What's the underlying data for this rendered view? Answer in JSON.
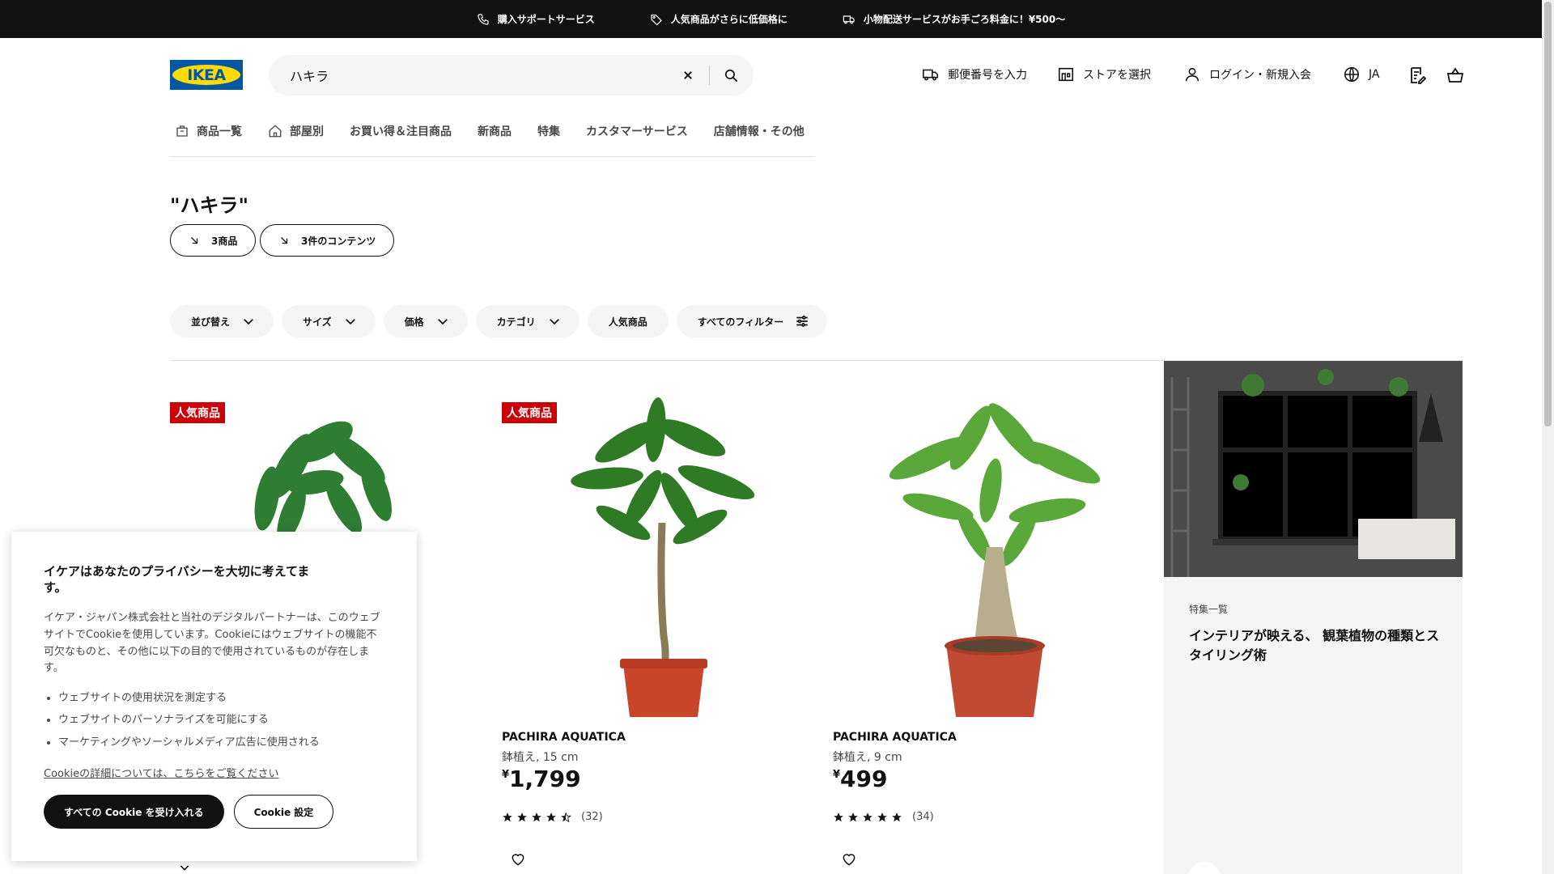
{
  "topbar": {
    "items": [
      {
        "label": "購入サポートサービス",
        "icon": "phone-icon"
      },
      {
        "label": "人気商品がさらに低価格に",
        "icon": "price-tag-icon"
      },
      {
        "label": "小物配送サービスがお手ごろ料金に！¥500〜",
        "icon": "truck-icon"
      }
    ]
  },
  "header": {
    "logo_text": "IKEA",
    "search": {
      "value": "ハキラ"
    },
    "postcode_label": "郵便番号を入力",
    "store_label": "ストアを選択",
    "login_label": "ログイン・新規入会",
    "language_label": "JA"
  },
  "nav": {
    "items": [
      {
        "label": "商品一覧"
      },
      {
        "label": "部屋別"
      },
      {
        "label": "お買い得＆注目商品"
      },
      {
        "label": "新商品"
      },
      {
        "label": "特集"
      },
      {
        "label": "カスタマーサービス"
      },
      {
        "label": "店舗情報・その他"
      }
    ]
  },
  "results": {
    "title": "\"ハキラ\"",
    "products_pill": "3商品",
    "content_pill": "3件のコンテンツ"
  },
  "filters": {
    "sort": "並び替え",
    "size": "サイズ",
    "price": "価格",
    "category": "カテゴリ",
    "popular": "人気商品",
    "all_filters": "すべてのフィルター"
  },
  "products": [
    {
      "badge": "人気商品",
      "name": "",
      "desc": "",
      "currency": "",
      "price": "",
      "rating": null,
      "count": ""
    },
    {
      "badge": "人気商品",
      "name": "PACHIRA AQUATICA",
      "desc": "鉢植え, 15 cm",
      "currency": "¥",
      "price": "1,799",
      "rating": 4.5,
      "count": "(32)"
    },
    {
      "badge": "",
      "name": "PACHIRA AQUATICA",
      "desc": "鉢植え, 9 cm",
      "currency": "¥",
      "price": "499",
      "rating": 5,
      "count": "(34)"
    }
  ],
  "editorial": {
    "kicker": "特集一覧",
    "title": "インテリアが映える、 観葉植物の種類とスタイリング術"
  },
  "cookie": {
    "title": "イケアはあなたのプライバシーを大切に考えてます。",
    "text": "イケア・ジャパン株式会社と当社のデジタルパートナーは、このウェブサイトでCookieを使用しています。Cookieにはウェブサイトの機能不可欠なものと、その他に以下の目的で使用されているものが存在します。",
    "list": [
      "ウェブサイトの使用状況を測定する",
      "ウェブサイトのパーソナライズを可能にする",
      "マーケティングやソーシャルメディア広告に使用される"
    ],
    "link": "Cookieの詳細については、こちらをご覧ください",
    "accept_label": "すべての Cookie を受け入れる",
    "settings_label": "Cookie 設定"
  },
  "colors": {
    "badge_red": "#cc0008",
    "ikea_blue": "#0058a3",
    "ikea_yellow": "#ffdb00"
  }
}
